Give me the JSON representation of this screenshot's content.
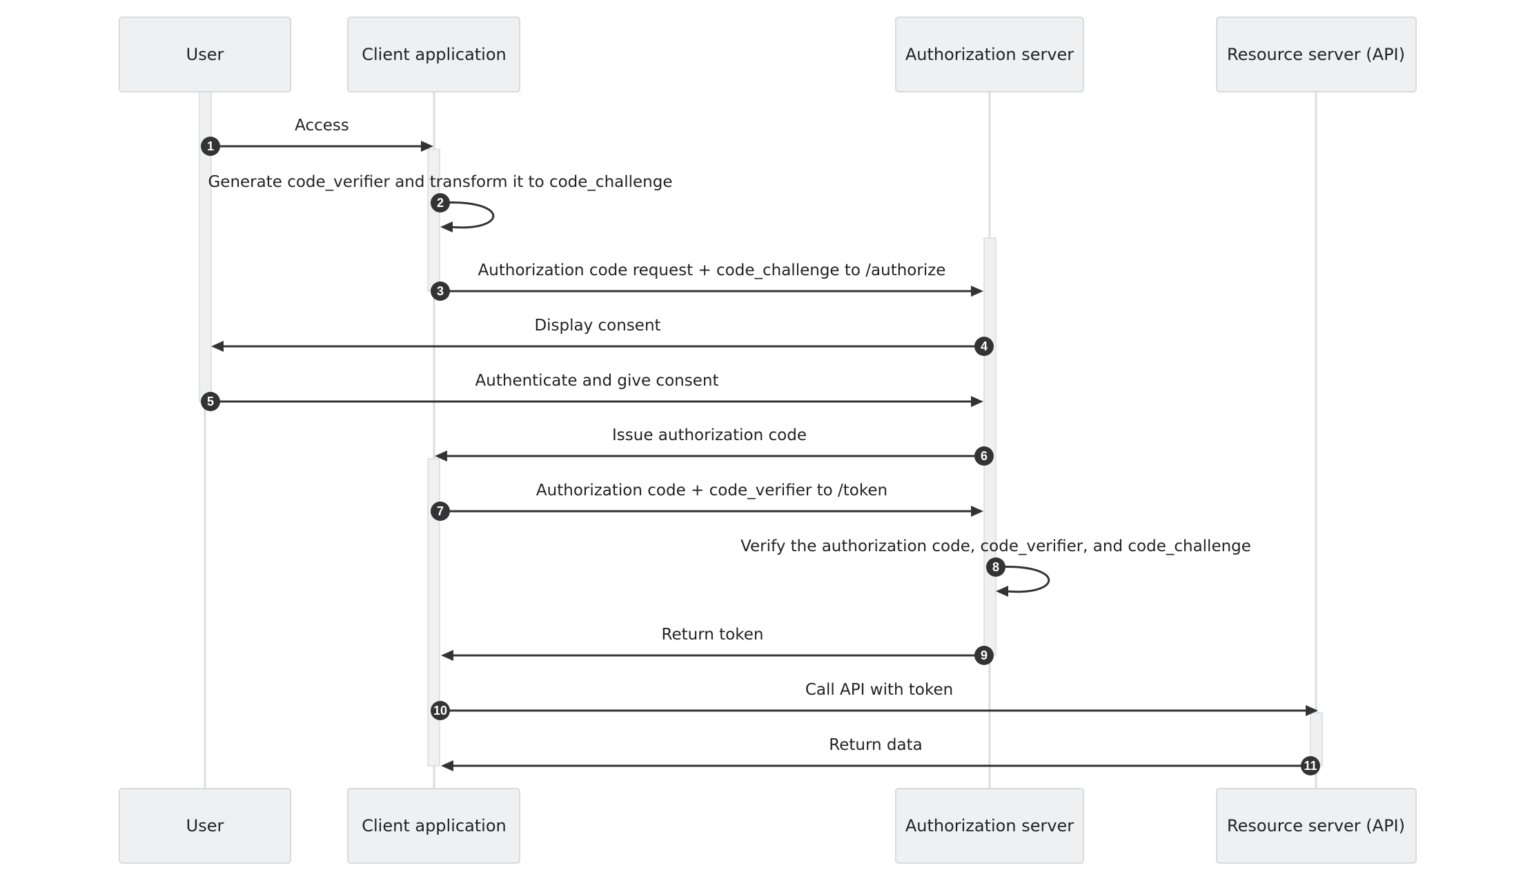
{
  "diagram": {
    "type": "sequence",
    "participants": [
      {
        "id": "user",
        "label": "User"
      },
      {
        "id": "client",
        "label": "Client application"
      },
      {
        "id": "auth",
        "label": "Authorization server"
      },
      {
        "id": "resource",
        "label": "Resource server (API)"
      }
    ],
    "messages": [
      {
        "seq": "1",
        "from": "user",
        "to": "client",
        "label": "Access"
      },
      {
        "seq": "2",
        "from": "client",
        "to": "client",
        "label": "Generate code_verifier and transform it to code_challenge"
      },
      {
        "seq": "3",
        "from": "client",
        "to": "auth",
        "label": "Authorization code request + code_challenge to /authorize"
      },
      {
        "seq": "4",
        "from": "auth",
        "to": "user",
        "label": "Display consent"
      },
      {
        "seq": "5",
        "from": "user",
        "to": "auth",
        "label": "Authenticate and give consent"
      },
      {
        "seq": "6",
        "from": "auth",
        "to": "client",
        "label": "Issue authorization code"
      },
      {
        "seq": "7",
        "from": "client",
        "to": "auth",
        "label": "Authorization code + code_verifier to /token"
      },
      {
        "seq": "8",
        "from": "auth",
        "to": "auth",
        "label": "Verify the authorization code, code_verifier, and code_challenge"
      },
      {
        "seq": "9",
        "from": "auth",
        "to": "client",
        "label": "Return token"
      },
      {
        "seq": "10",
        "from": "client",
        "to": "resource",
        "label": "Call API with token"
      },
      {
        "seq": "11",
        "from": "resource",
        "to": "client",
        "label": "Return data"
      }
    ],
    "activations": [
      {
        "participant": "user",
        "from_step": "start",
        "to_step": "5"
      },
      {
        "participant": "client",
        "from_step": "1",
        "to_step": "3"
      },
      {
        "participant": "auth",
        "from_step": "3",
        "to_step": "9"
      },
      {
        "participant": "client",
        "from_step": "6",
        "to_step": "11"
      },
      {
        "participant": "resource",
        "from_step": "10",
        "to_step": "11"
      }
    ],
    "colors": {
      "actor_fill": "#eff0f2",
      "actor_border": "#d9dadc",
      "lifeline": "#dcdcdc",
      "line": "#333333",
      "text": "#222222"
    }
  }
}
